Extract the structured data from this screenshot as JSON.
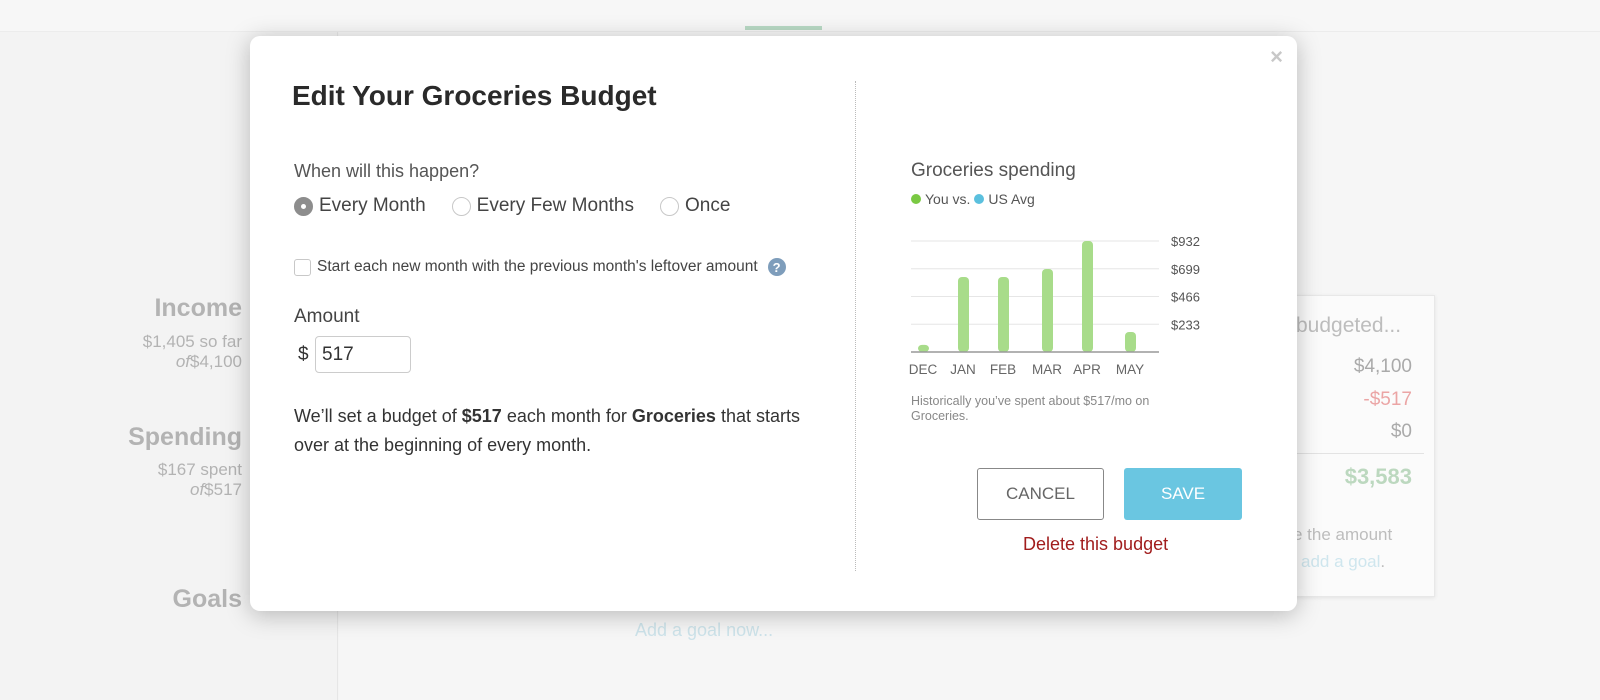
{
  "sidebar": {
    "income": {
      "label": "Income",
      "sofar": "$1,405 so far",
      "of": "of",
      "total": "$4,100"
    },
    "spending": {
      "label": "Spending",
      "spent": "$167 spent",
      "of": "of",
      "total": "$517"
    },
    "goals": {
      "label": "Goals"
    }
  },
  "card": {
    "title": "budgeted...",
    "row1": "$4,100",
    "row2_label": ":",
    "row2": "-$517",
    "row3": "$0",
    "total": "$3,583",
    "text": "e the amount",
    "link": "add a goal",
    "period": "."
  },
  "bottom_link": "Add a goal now...",
  "modal": {
    "title": "Edit Your Groceries Budget",
    "question": "When will this happen?",
    "options": [
      {
        "label": "Every Month",
        "selected": true
      },
      {
        "label": "Every Few Months",
        "selected": false
      },
      {
        "label": "Once",
        "selected": false
      }
    ],
    "rollover_label": "Start each new month with the previous month's leftover amount",
    "rollover_checked": false,
    "help": "?",
    "amount_label": "Amount",
    "currency": "$",
    "amount_value": "517",
    "desc_1": "We’ll set a budget of ",
    "desc_amt": "$517",
    "desc_2": " each month for ",
    "desc_cat": "Groceries",
    "desc_3": " that starts over at the beginning of every month.",
    "cancel": "CANCEL",
    "save": "SAVE",
    "delete": "Delete this budget",
    "close": "×"
  },
  "colors": {
    "you": "#7ac943",
    "us_avg": "#5bc0de",
    "bar": "#a8dc8a",
    "save": "#6ac6e1",
    "delete": "#a11d1d"
  },
  "chart_data": {
    "type": "bar",
    "title": "Groceries spending",
    "legend": [
      {
        "label": "You vs.",
        "color": "#7ac943"
      },
      {
        "label": "US Avg",
        "color": "#5bc0de"
      }
    ],
    "categories": [
      "DEC",
      "JAN",
      "FEB",
      "MAR",
      "APR",
      "MAY"
    ],
    "values": [
      60,
      630,
      630,
      697,
      932,
      168
    ],
    "yticks": [
      "$233",
      "$466",
      "$699",
      "$932"
    ],
    "ytick_values": [
      233,
      466,
      699,
      932
    ],
    "ylim": [
      0,
      932
    ],
    "grid": true,
    "note": "Historically you’ve spent about $517/mo on Groceries."
  }
}
